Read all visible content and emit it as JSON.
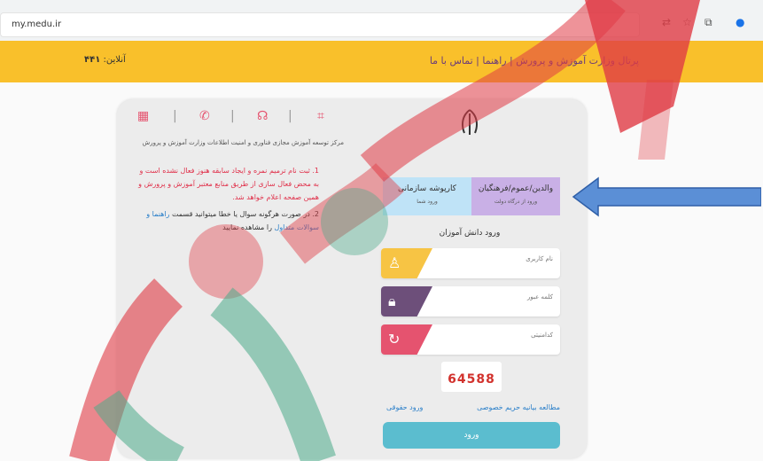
{
  "browser": {
    "url": "my.medu.ir"
  },
  "topbar": {
    "nav_links": "پرتال وزارت آموزش و پرورش | راهنما | تماس با ما",
    "online_label": "آنلاین:",
    "online_count": "۴۴۱"
  },
  "left": {
    "center_text": "مرکز توسعه آموزش مجازی فناوری و امنیت اطلاعات وزارت آموزش و پرورش",
    "notice_1": "1. ثبت نام ترمیم نمره و ایجاد سابقه هنوز فعال نشده است و به محض فعال سازی از طریق منابع معتبر آموزش و پرورش و همین صفحه اعلام خواهد شد.",
    "notice_2_a": "2. در صورت هرگونه سوال یا خطا میتوانید قسمت",
    "notice_2_link": "راهنما و سوالات متداول",
    "notice_2_b": "را مشاهده نمایید"
  },
  "tabs": [
    {
      "title": "کارپوشه سازمانی",
      "sub": "ورود شما"
    },
    {
      "title": "والدین/عموم/فرهنگیان",
      "sub": "ورود از درگاه دولت"
    }
  ],
  "form": {
    "section_title": "ورود دانش آموزان",
    "username_placeholder": "نام کاربری",
    "password_placeholder": "کلمه عبور",
    "captcha_placeholder": "کدامنیتی",
    "captcha_code": "64588",
    "link_privacy": "مطالعه بیانیه حریم خصوصی",
    "link_legal": "ورود حقوقی",
    "submit": "ورود"
  },
  "colors": {
    "topbar": "#f9c02b",
    "field_user": "#f7c444",
    "field_pass": "#6d4f7a",
    "field_captcha": "#e5536f",
    "submit": "#5bbdcf"
  }
}
